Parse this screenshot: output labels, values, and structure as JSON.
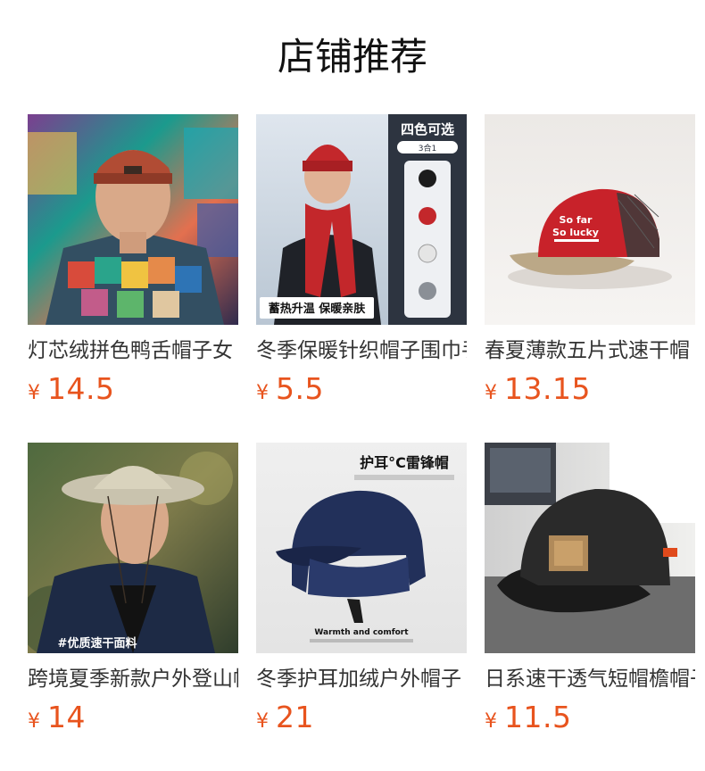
{
  "section": {
    "title": "店铺推荐"
  },
  "products": [
    {
      "name": "灯芯绒拼色鸭舌帽子女",
      "currency": "¥",
      "price": "14.5",
      "image_texts": []
    },
    {
      "name": "冬季保暖针织帽子围巾手套",
      "currency": "¥",
      "price": "5.5",
      "image_texts": [
        "四色可选",
        "3合1",
        "蓄热升温 保暖亲肤"
      ]
    },
    {
      "name": "春夏薄款五片式速干帽",
      "currency": "¥",
      "price": "13.15",
      "image_texts": [
        "So far",
        "So lucky"
      ]
    },
    {
      "name": "跨境夏季新款户外登山帽",
      "currency": "¥",
      "price": "14",
      "image_texts": [
        "#优质速干面料"
      ]
    },
    {
      "name": "冬季护耳加绒户外帽子",
      "currency": "¥",
      "price": "21",
      "image_texts": [
        "护耳°C雷锋帽",
        "Warmth and comfort"
      ]
    },
    {
      "name": "日系速干透气短帽檐帽子",
      "currency": "¥",
      "price": "11.5",
      "image_texts": []
    }
  ],
  "colors": {
    "price": "#e8541e",
    "title": "#111111",
    "name": "#333333"
  }
}
